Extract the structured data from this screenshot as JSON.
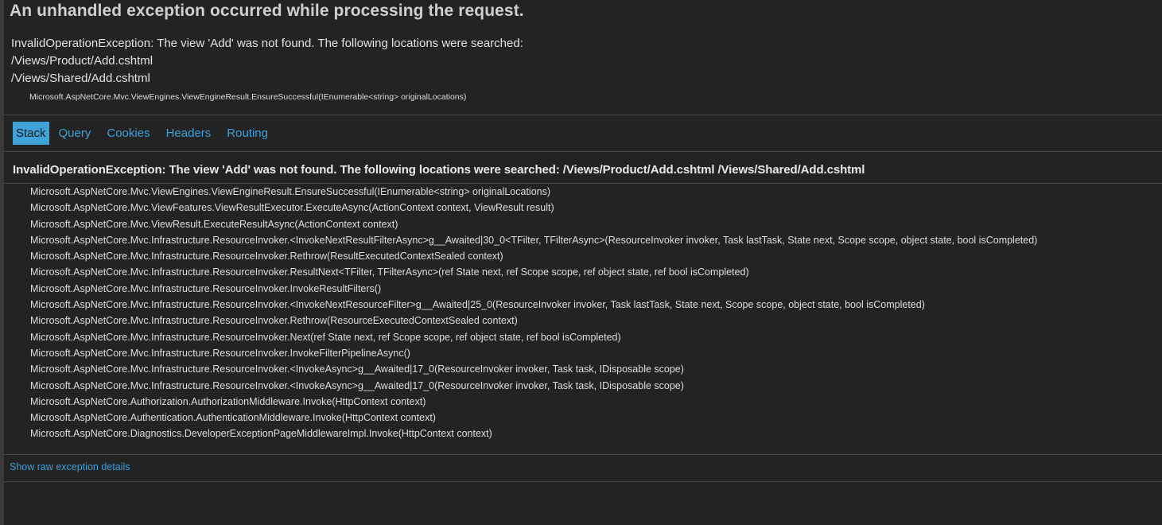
{
  "page": {
    "title": "An unhandled exception occurred while processing the request."
  },
  "summary": {
    "lines": [
      "InvalidOperationException: The view 'Add' was not found. The following locations were searched:",
      "/Views/Product/Add.cshtml",
      "/Views/Shared/Add.cshtml"
    ],
    "frame": "Microsoft.AspNetCore.Mvc.ViewEngines.ViewEngineResult.EnsureSuccessful(IEnumerable<string> originalLocations)"
  },
  "tabs": [
    {
      "label": "Stack",
      "active": true
    },
    {
      "label": "Query",
      "active": false
    },
    {
      "label": "Cookies",
      "active": false
    },
    {
      "label": "Headers",
      "active": false
    },
    {
      "label": "Routing",
      "active": false
    }
  ],
  "stack": {
    "title": "InvalidOperationException: The view 'Add' was not found. The following locations were searched: /Views/Product/Add.cshtml /Views/Shared/Add.cshtml",
    "frames": [
      "Microsoft.AspNetCore.Mvc.ViewEngines.ViewEngineResult.EnsureSuccessful(IEnumerable<string> originalLocations)",
      "Microsoft.AspNetCore.Mvc.ViewFeatures.ViewResultExecutor.ExecuteAsync(ActionContext context, ViewResult result)",
      "Microsoft.AspNetCore.Mvc.ViewResult.ExecuteResultAsync(ActionContext context)",
      "Microsoft.AspNetCore.Mvc.Infrastructure.ResourceInvoker.<InvokeNextResultFilterAsync>g__Awaited|30_0<TFilter, TFilterAsync>(ResourceInvoker invoker, Task lastTask, State next, Scope scope, object state, bool isCompleted)",
      "Microsoft.AspNetCore.Mvc.Infrastructure.ResourceInvoker.Rethrow(ResultExecutedContextSealed context)",
      "Microsoft.AspNetCore.Mvc.Infrastructure.ResourceInvoker.ResultNext<TFilter, TFilterAsync>(ref State next, ref Scope scope, ref object state, ref bool isCompleted)",
      "Microsoft.AspNetCore.Mvc.Infrastructure.ResourceInvoker.InvokeResultFilters()",
      "Microsoft.AspNetCore.Mvc.Infrastructure.ResourceInvoker.<InvokeNextResourceFilter>g__Awaited|25_0(ResourceInvoker invoker, Task lastTask, State next, Scope scope, object state, bool isCompleted)",
      "Microsoft.AspNetCore.Mvc.Infrastructure.ResourceInvoker.Rethrow(ResourceExecutedContextSealed context)",
      "Microsoft.AspNetCore.Mvc.Infrastructure.ResourceInvoker.Next(ref State next, ref Scope scope, ref object state, ref bool isCompleted)",
      "Microsoft.AspNetCore.Mvc.Infrastructure.ResourceInvoker.InvokeFilterPipelineAsync()",
      "Microsoft.AspNetCore.Mvc.Infrastructure.ResourceInvoker.<InvokeAsync>g__Awaited|17_0(ResourceInvoker invoker, Task task, IDisposable scope)",
      "Microsoft.AspNetCore.Mvc.Infrastructure.ResourceInvoker.<InvokeAsync>g__Awaited|17_0(ResourceInvoker invoker, Task task, IDisposable scope)",
      "Microsoft.AspNetCore.Authorization.AuthorizationMiddleware.Invoke(HttpContext context)",
      "Microsoft.AspNetCore.Authentication.AuthenticationMiddleware.Invoke(HttpContext context)",
      "Microsoft.AspNetCore.Diagnostics.DeveloperExceptionPageMiddlewareImpl.Invoke(HttpContext context)"
    ]
  },
  "raw_link": "Show raw exception details",
  "colors": {
    "background": "#232323",
    "link": "#3ea0dc",
    "active_tab": "#3fa3d8"
  }
}
